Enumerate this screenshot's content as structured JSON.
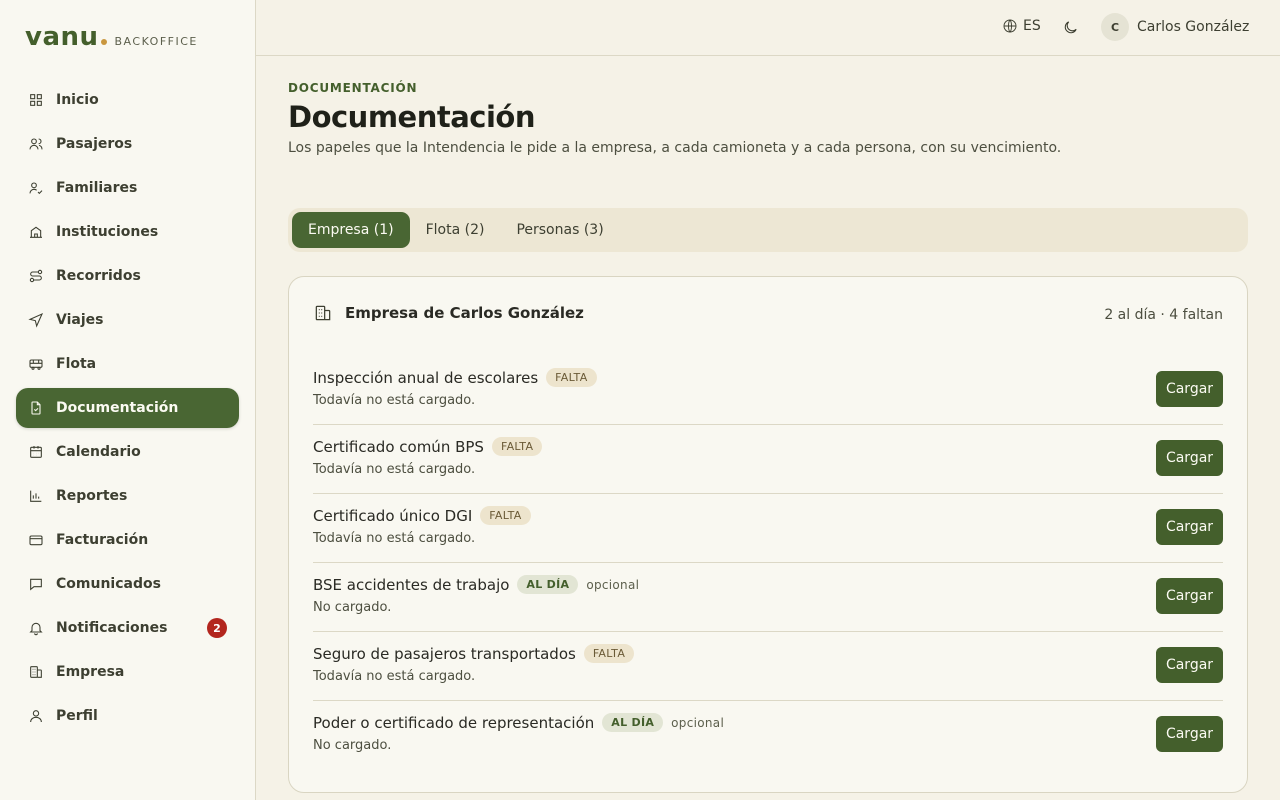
{
  "brand": {
    "name": "vanu",
    "sub": "BACKOFFICE"
  },
  "sidebar": {
    "items": [
      {
        "label": "Inicio",
        "icon": "grid-icon"
      },
      {
        "label": "Pasajeros",
        "icon": "users-icon"
      },
      {
        "label": "Familiares",
        "icon": "user-check-icon"
      },
      {
        "label": "Instituciones",
        "icon": "school-icon"
      },
      {
        "label": "Recorridos",
        "icon": "route-icon"
      },
      {
        "label": "Viajes",
        "icon": "navigation-icon"
      },
      {
        "label": "Flota",
        "icon": "bus-icon"
      },
      {
        "label": "Documentación",
        "icon": "file-check-icon",
        "active": true
      },
      {
        "label": "Calendario",
        "icon": "calendar-icon"
      },
      {
        "label": "Reportes",
        "icon": "bar-chart-icon"
      },
      {
        "label": "Facturación",
        "icon": "credit-card-icon"
      },
      {
        "label": "Comunicados",
        "icon": "message-icon"
      },
      {
        "label": "Notificaciones",
        "icon": "bell-icon",
        "badge": "2"
      },
      {
        "label": "Empresa",
        "icon": "building-icon"
      },
      {
        "label": "Perfil",
        "icon": "user-icon"
      }
    ]
  },
  "header": {
    "lang": "ES",
    "user_initial": "C",
    "user_name": "Carlos González"
  },
  "page": {
    "eyebrow": "DOCUMENTACIÓN",
    "title": "Documentación",
    "subtitle": "Los papeles que la Intendencia le pide a la empresa, a cada camioneta y a cada persona, con su vencimiento."
  },
  "tabs": [
    {
      "label": "Empresa (1)",
      "active": true
    },
    {
      "label": "Flota (2)"
    },
    {
      "label": "Personas (3)"
    }
  ],
  "card": {
    "title": "Empresa de Carlos González",
    "stat": "2 al día · 4 faltan",
    "button_label": "Cargar",
    "rows": [
      {
        "title": "Inspección anual de escolares",
        "status": "FALTA",
        "kind": "falta",
        "optional": "",
        "sub": "Todavía no está cargado."
      },
      {
        "title": "Certificado común BPS",
        "status": "FALTA",
        "kind": "falta",
        "optional": "",
        "sub": "Todavía no está cargado."
      },
      {
        "title": "Certificado único DGI",
        "status": "FALTA",
        "kind": "falta",
        "optional": "",
        "sub": "Todavía no está cargado."
      },
      {
        "title": "BSE accidentes de trabajo",
        "status": "AL DÍA",
        "kind": "aldia",
        "optional": "opcional",
        "sub": "No cargado."
      },
      {
        "title": "Seguro de pasajeros transportados",
        "status": "FALTA",
        "kind": "falta",
        "optional": "",
        "sub": "Todavía no está cargado."
      },
      {
        "title": "Poder o certificado de representación",
        "status": "AL DÍA",
        "kind": "aldia",
        "optional": "opcional",
        "sub": "No cargado."
      }
    ]
  }
}
